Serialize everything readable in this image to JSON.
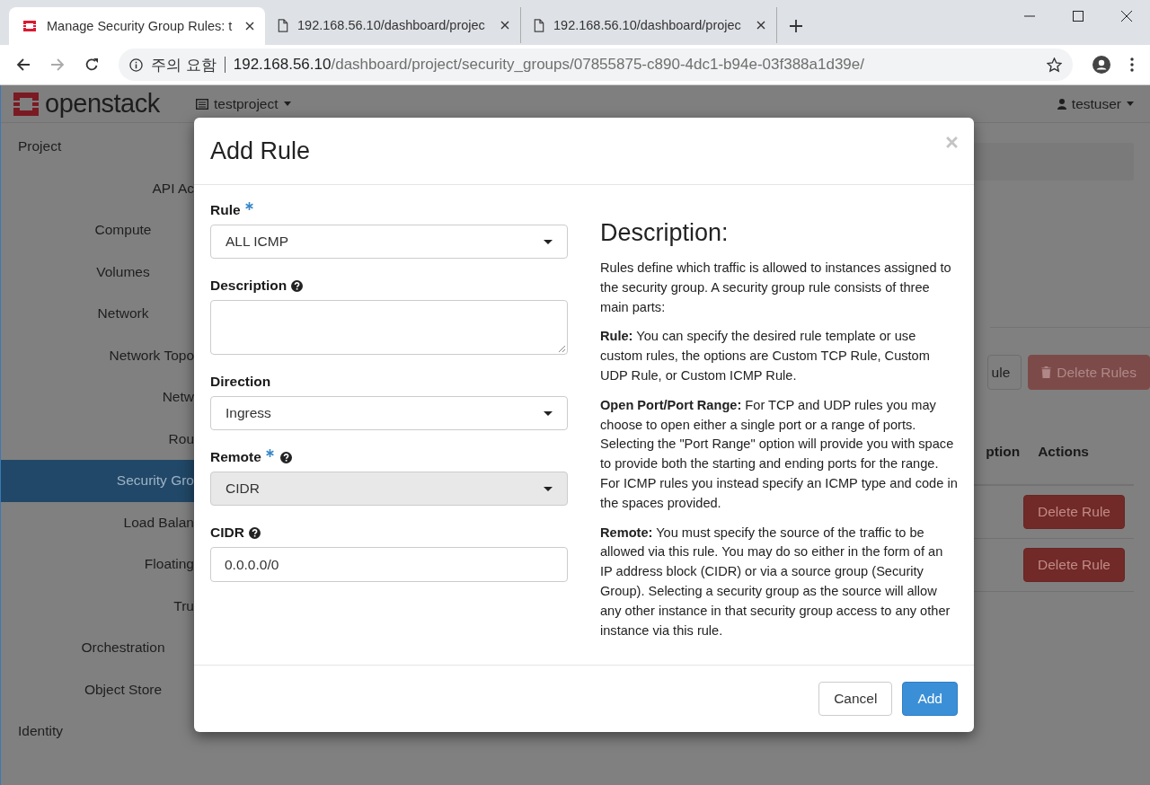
{
  "browser": {
    "tabs": [
      {
        "title": "Manage Security Group Rules: t",
        "kind": "site",
        "selected": true
      },
      {
        "title": "192.168.56.10/dashboard/projec",
        "kind": "page",
        "selected": false
      },
      {
        "title": "192.168.56.10/dashboard/projec",
        "kind": "page",
        "selected": false
      }
    ],
    "security_label": "주의 요함",
    "url_host": "192.168.56.10",
    "url_path": "/dashboard/project/security_groups/07855875-c890-4dc1-b94e-03f388a1d39e/"
  },
  "header": {
    "logo": "openstack",
    "project": "testproject",
    "user": "testuser"
  },
  "sidebar": [
    {
      "label": "Project",
      "kind": "dashboard",
      "selected": false,
      "children": [
        {
          "label": "API Ac",
          "kind": "panel",
          "selected": false
        },
        {
          "label": "Compute",
          "kind": "group",
          "selected": false
        },
        {
          "label": "Volumes",
          "kind": "group",
          "selected": false
        },
        {
          "label": "Network",
          "kind": "group",
          "selected": false,
          "children": [
            {
              "label": "Network Topo",
              "kind": "panel",
              "selected": false
            },
            {
              "label": "Netw",
              "kind": "panel",
              "selected": false
            },
            {
              "label": "Rou",
              "kind": "panel",
              "selected": false
            },
            {
              "label": "Security Gro",
              "kind": "panel",
              "selected": true
            },
            {
              "label": "Load Balan",
              "kind": "panel",
              "selected": false
            },
            {
              "label": "Floating",
              "kind": "panel",
              "selected": false
            },
            {
              "label": "Tru",
              "kind": "panel",
              "selected": false
            }
          ]
        },
        {
          "label": "Orchestration",
          "kind": "group",
          "selected": false
        },
        {
          "label": "Object Store",
          "kind": "group",
          "selected": false
        }
      ]
    },
    {
      "label": "Identity",
      "kind": "dashboard",
      "selected": false
    }
  ],
  "page": {
    "buttons": [
      {
        "label": "ule",
        "kind": "default"
      },
      {
        "label": "Delete Rules",
        "kind": "danger-disabled"
      }
    ],
    "columns": [
      "ption",
      "Actions"
    ],
    "rows": [
      {
        "action": "Delete Rule"
      },
      {
        "action": "Delete Rule"
      }
    ]
  },
  "modal": {
    "title": "Add Rule",
    "fields": [
      {
        "label": "Rule",
        "kind": "select",
        "required": true,
        "help": false,
        "value": "ALL ICMP",
        "disabled": false
      },
      {
        "label": "Description",
        "kind": "textarea",
        "required": false,
        "help": true
      },
      {
        "label": "Direction",
        "kind": "select",
        "required": false,
        "help": false,
        "value": "Ingress",
        "disabled": false
      },
      {
        "label": "Remote",
        "kind": "select",
        "required": true,
        "help": true,
        "value": "CIDR",
        "disabled": true
      },
      {
        "label": "CIDR",
        "kind": "input",
        "required": false,
        "help": true,
        "value": "0.0.0.0/0"
      }
    ],
    "description_title": "Description:",
    "description": [
      "Rules define which traffic is allowed to instances assigned to the security group. A security group rule consists of three main parts:",
      "**Rule:** You can specify the desired rule template or use custom rules, the options are Custom TCP Rule, Custom UDP Rule, or Custom ICMP Rule.",
      "**Open Port/Port Range:** For TCP and UDP rules you may choose to open either a single port or a range of ports. Selecting the \"Port Range\" option will provide you with space to provide both the starting and ending ports for the range. For ICMP rules you instead specify an ICMP type and code in the spaces provided.",
      "**Remote:** You must specify the source of the traffic to be allowed via this rule. You may do so either in the form of an IP address block (CIDR) or via a source group (Security Group). Selecting a security group as the source will allow any other instance in that security group access to any other instance via this rule."
    ],
    "buttons": [
      {
        "label": "Cancel",
        "kind": "default"
      },
      {
        "label": "Add",
        "kind": "primary"
      }
    ]
  }
}
